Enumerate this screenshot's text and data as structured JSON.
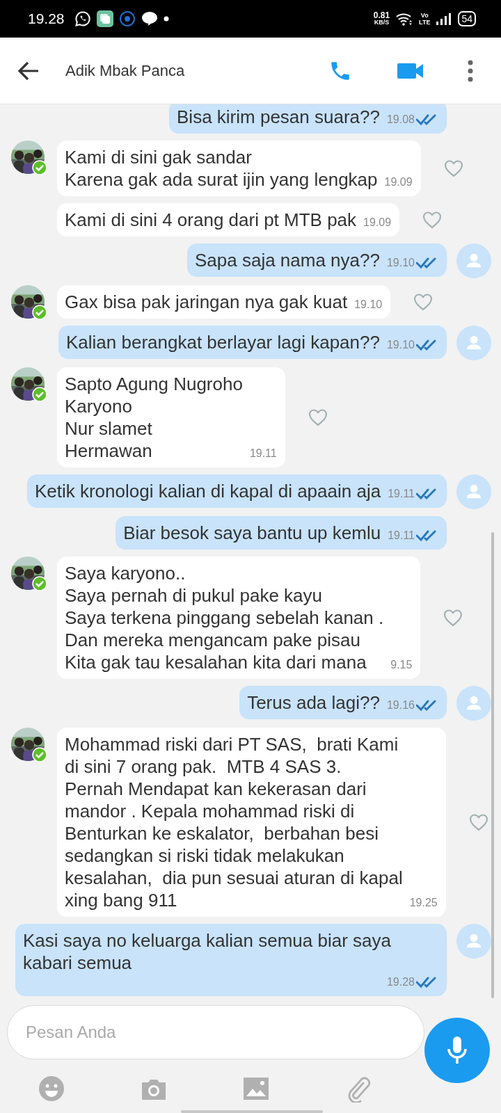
{
  "status_bar": {
    "time": "19.28",
    "net_speed": "0.81",
    "net_unit": "KB/S",
    "volte_top": "Vo",
    "volte_bottom": "LTE",
    "battery": "54"
  },
  "header": {
    "title": "Adik Mbak Panca"
  },
  "messages": [
    {
      "kind": "out",
      "text": "Bisa kirim pesan suara??",
      "time": "19.08",
      "read": true,
      "avatar": false
    },
    {
      "kind": "in",
      "text": "Kami di sini gak sandar\nKarena gak ada surat ijin yang lengkap",
      "time": "19.09",
      "avatar": true,
      "liked": false
    },
    {
      "kind": "in",
      "text": "Kami di sini 4 orang dari pt MTB pak",
      "time": "19.09",
      "avatar": false,
      "liked": false
    },
    {
      "kind": "out",
      "text": "Sapa saja nama nya??",
      "time": "19.10",
      "read": true,
      "avatar": true
    },
    {
      "kind": "in",
      "text": "Gax bisa pak jaringan nya gak kuat",
      "time": "19.10",
      "avatar": true,
      "liked": false
    },
    {
      "kind": "out",
      "text": "Kalian berangkat berlayar lagi kapan??",
      "time": "19.10",
      "read": true,
      "avatar": true
    },
    {
      "kind": "in",
      "text": "Sapto Agung Nugroho\nKaryono\nNur slamet\nHermawan",
      "time": "19.11",
      "avatar": true,
      "liked": false
    },
    {
      "kind": "out",
      "text": "Ketik kronologi kalian di kapal di apaain aja",
      "time": "19.11",
      "read": true,
      "avatar": true
    },
    {
      "kind": "out",
      "text": "Biar besok saya bantu up kemlu",
      "time": "19.11",
      "read": true,
      "avatar": false
    },
    {
      "kind": "in",
      "text": "Saya karyono..\nSaya pernah di pukul pake kayu\nSaya terkena pinggang sebelah kanan .\nDan mereka mengancam pake pisau\nKita gak tau kesalahan kita dari mana",
      "time": "9.15",
      "avatar": true,
      "liked": false
    },
    {
      "kind": "out",
      "text": "Terus ada lagi??",
      "time": "19.16",
      "read": true,
      "avatar": true
    },
    {
      "kind": "in",
      "text": "Mohammad riski dari PT SAS,  brati Kami\ndi sini 7 orang pak.  MTB 4 SAS 3.\nPernah Mendapat kan kekerasan dari\nmandor . Kepala mohammad riski di\nBenturkan ke eskalator,  berbahan besi\nsedangkan si riski tidak melakukan\nkesalahan,  dia pun sesuai aturan di kapal\nxing bang 911",
      "time": "19.25",
      "avatar": true,
      "liked": false
    },
    {
      "kind": "out",
      "text": "Kasi saya no keluarga kalian semua biar saya\nkabari semua",
      "time": "19.28",
      "read": true,
      "avatar": true
    }
  ],
  "composer": {
    "placeholder": "Pesan Anda"
  }
}
